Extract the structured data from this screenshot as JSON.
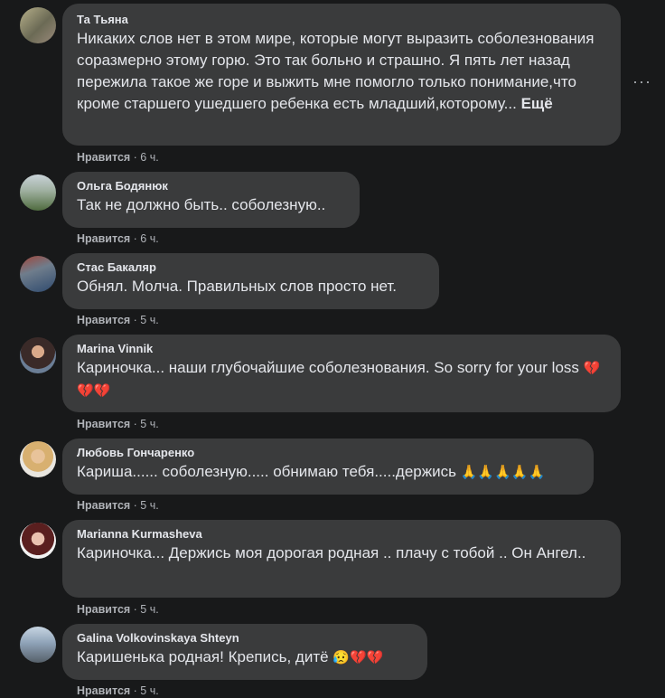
{
  "comments": [
    {
      "author": "Та Тьяна",
      "text": "Никаких слов нет в этом мире, которые могут выразить соболезнования соразмерно этому горю. Это так больно и страшно. Я пять лет назад пережила такое же горе и выжить мне помогло только понимание,что кроме старшего ушедшего ребенка есть младший,которому...",
      "more": "Ещё",
      "like": "Нравится",
      "time": "· 6 ч.",
      "avatar_color": "#8a8f6b"
    },
    {
      "author": "Ольга Бодянюк",
      "text": "Так не должно быть.. соболезную..",
      "like": "Нравится",
      "time": "· 6 ч.",
      "avatar_color": "#6f8a5a"
    },
    {
      "author": "Стас Бакаляр",
      "text": "Обнял. Молча. Правильных слов просто нет.",
      "like": "Нравится",
      "time": "· 5 ч.",
      "avatar_color": "#5d6f86"
    },
    {
      "author": "Marina Vinnik",
      "text": "Кариночка... наши глубочайшие соболезнования. So sorry for your loss",
      "emoji": "💔💔💔",
      "like": "Нравится",
      "time": "· 5 ч.",
      "avatar_color": "#7a5a52"
    },
    {
      "author": "Любовь Гончаренко",
      "text": "Кариша...... соболезную..... обнимаю тебя.....держись",
      "emoji": "🙏🙏🙏🙏🙏",
      "like": "Нравится",
      "time": "· 5 ч.",
      "avatar_color": "#c8a67a"
    },
    {
      "author": "Marianna Kurmasheva",
      "text": "Кариночка... Держись моя дорогая родная .. плачу с тобой .. Он Ангел..",
      "like": "Нравится",
      "time": "· 5 ч.",
      "avatar_color": "#8c4a4a"
    },
    {
      "author": "Galina Volkovinskaya Shteyn",
      "text": "Каришенька родная! Крепись, дитё",
      "emoji": "😥💔💔",
      "like": "Нравится",
      "time": "· 5 ч.",
      "avatar_color": "#7d8fa3"
    }
  ],
  "menu_icon": "more-options-icon"
}
